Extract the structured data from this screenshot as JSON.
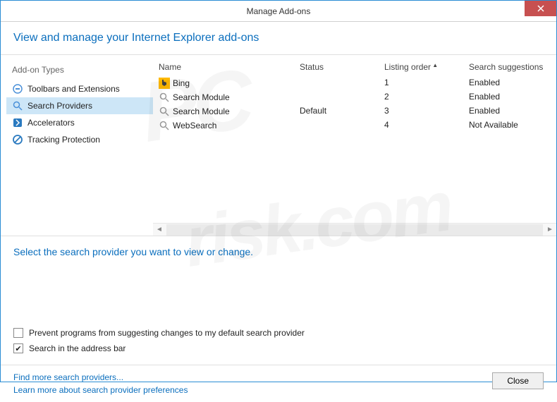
{
  "window": {
    "title": "Manage Add-ons"
  },
  "header": {
    "title": "View and manage your Internet Explorer add-ons"
  },
  "sidebar": {
    "title": "Add-on Types",
    "items": [
      {
        "label": "Toolbars and Extensions"
      },
      {
        "label": "Search Providers"
      },
      {
        "label": "Accelerators"
      },
      {
        "label": "Tracking Protection"
      }
    ]
  },
  "table": {
    "cols": {
      "name": "Name",
      "status": "Status",
      "order": "Listing order",
      "sugg": "Search suggestions"
    },
    "rows": [
      {
        "name": "Bing",
        "status": "",
        "order": "1",
        "sugg": "Enabled"
      },
      {
        "name": "Search Module",
        "status": "",
        "order": "2",
        "sugg": "Enabled"
      },
      {
        "name": "Search Module",
        "status": "Default",
        "order": "3",
        "sugg": "Enabled"
      },
      {
        "name": "WebSearch",
        "status": "",
        "order": "4",
        "sugg": "Not Available"
      }
    ]
  },
  "lower": {
    "title": "Select the search provider you want to view or change.",
    "chk1": "Prevent programs from suggesting changes to my default search provider",
    "chk2": "Search in the address bar"
  },
  "footer": {
    "link1": "Find more search providers...",
    "link2": "Learn more about search provider preferences",
    "close": "Close"
  }
}
